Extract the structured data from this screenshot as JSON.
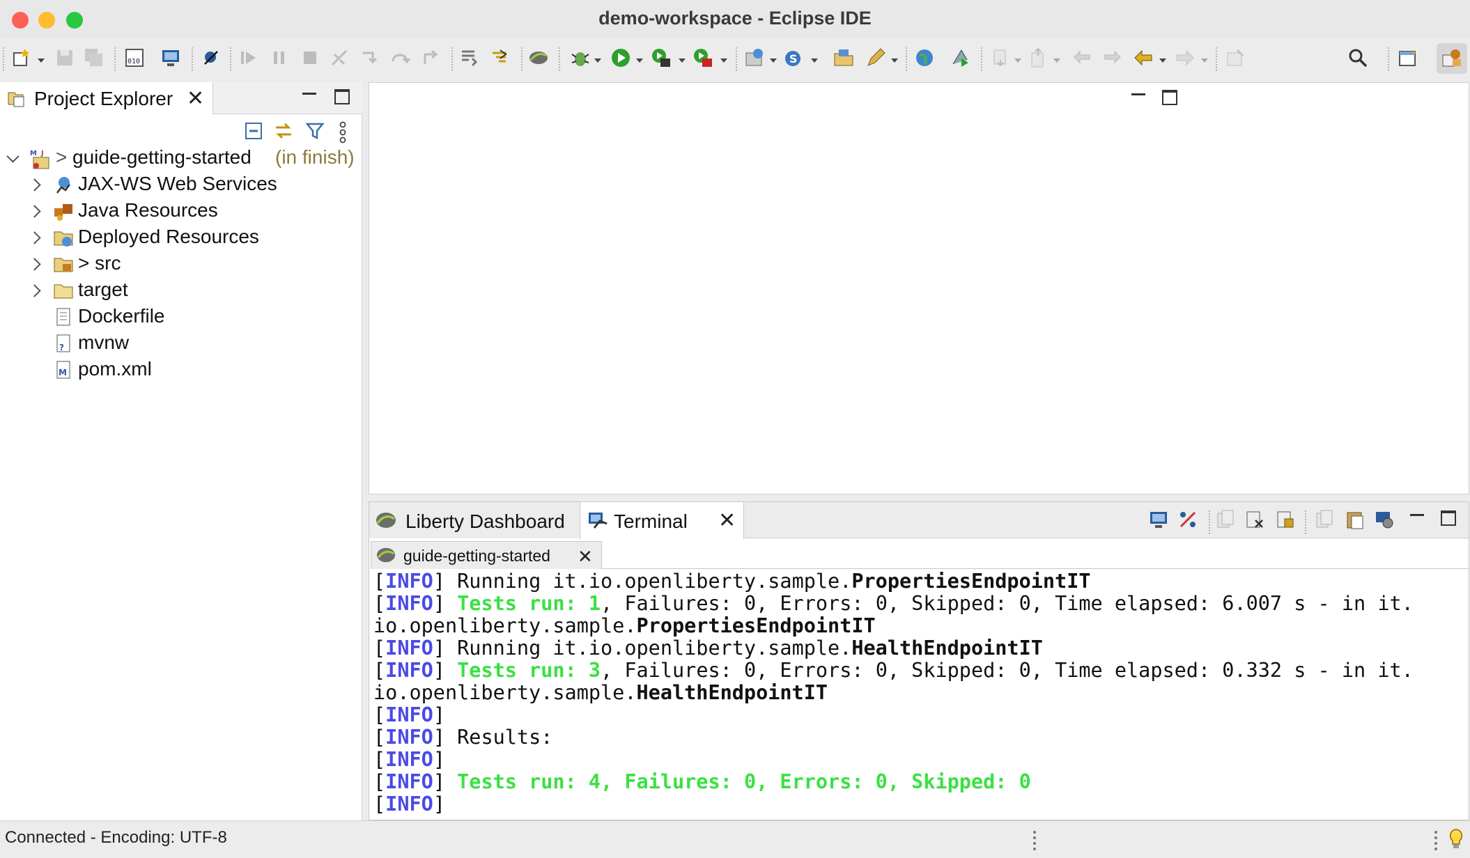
{
  "window": {
    "title": "demo-workspace - Eclipse IDE",
    "traffic_lights": {
      "close": "#ff5f57",
      "minimize": "#febc2e",
      "zoom": "#28c840"
    }
  },
  "toolbar": {
    "icons": [
      "new-wizard-icon",
      "save-icon",
      "save-all-icon",
      "binary-icon",
      "open-terminal-icon",
      "skip-breakpoints-icon",
      "resume-icon",
      "suspend-icon",
      "terminate-icon",
      "disconnect-icon",
      "step-into-icon",
      "step-over-icon",
      "step-return-icon",
      "drop-to-frame-icon",
      "use-step-filters-icon",
      "liberty-icon",
      "debug-icon",
      "run-icon",
      "coverage-icon",
      "external-tools-icon",
      "new-server-icon",
      "new-service-icon",
      "open-folder-icon",
      "edit-icon",
      "globe-icon",
      "deploy-icon",
      "next-annotation-icon",
      "prev-annotation-icon",
      "last-edit-icon",
      "forward-edit-icon",
      "back-icon",
      "forward-icon",
      "pin-editor-icon",
      "search-icon",
      "open-perspective-icon",
      "java-ee-perspective-icon"
    ]
  },
  "project_explorer": {
    "tab_label": "Project Explorer",
    "root": {
      "marker": ">",
      "name": "guide-getting-started",
      "decoration": "(in finish)"
    },
    "items": [
      {
        "label": "JAX-WS Web Services",
        "expandable": true,
        "icon": "web-services-icon"
      },
      {
        "label": "Java Resources",
        "expandable": true,
        "icon": "java-resources-icon"
      },
      {
        "label": "Deployed Resources",
        "expandable": true,
        "icon": "deployed-resources-icon"
      },
      {
        "label": "> src",
        "expandable": true,
        "icon": "source-folder-icon"
      },
      {
        "label": "target",
        "expandable": true,
        "icon": "folder-icon"
      },
      {
        "label": "Dockerfile",
        "expandable": false,
        "icon": "file-icon"
      },
      {
        "label": "mvnw",
        "expandable": false,
        "icon": "unknown-file-icon"
      },
      {
        "label": "pom.xml",
        "expandable": false,
        "icon": "maven-pom-icon"
      }
    ],
    "decoration_color": "#8b7a3a"
  },
  "bottom_panel": {
    "tabs": [
      {
        "label": "Liberty Dashboard"
      },
      {
        "label": "Terminal"
      }
    ],
    "terminal_tab": "guide-getting-started",
    "console_lines": [
      [
        {
          "t": "[",
          "s": "n"
        },
        {
          "t": "INFO",
          "s": "info"
        },
        {
          "t": "] Running it.io.openliberty.sample.",
          "s": "n"
        },
        {
          "t": "PropertiesEndpointIT",
          "s": "b"
        }
      ],
      [
        {
          "t": "[",
          "s": "n"
        },
        {
          "t": "INFO",
          "s": "info"
        },
        {
          "t": "] ",
          "s": "n"
        },
        {
          "t": "Tests run: 1",
          "s": "g"
        },
        {
          "t": ", Failures: 0, Errors: 0, Skipped: 0, Time elapsed: 6.007 s - in it.",
          "s": "n"
        }
      ],
      [
        {
          "t": "io.openliberty.sample.",
          "s": "n"
        },
        {
          "t": "PropertiesEndpointIT",
          "s": "b"
        }
      ],
      [
        {
          "t": "[",
          "s": "n"
        },
        {
          "t": "INFO",
          "s": "info"
        },
        {
          "t": "] Running it.io.openliberty.sample.",
          "s": "n"
        },
        {
          "t": "HealthEndpointIT",
          "s": "b"
        }
      ],
      [
        {
          "t": "[",
          "s": "n"
        },
        {
          "t": "INFO",
          "s": "info"
        },
        {
          "t": "] ",
          "s": "n"
        },
        {
          "t": "Tests run: 3",
          "s": "g"
        },
        {
          "t": ", Failures: 0, Errors: 0, Skipped: 0, Time elapsed: 0.332 s - in it.",
          "s": "n"
        }
      ],
      [
        {
          "t": "io.openliberty.sample.",
          "s": "n"
        },
        {
          "t": "HealthEndpointIT",
          "s": "b"
        }
      ],
      [
        {
          "t": "[",
          "s": "n"
        },
        {
          "t": "INFO",
          "s": "info"
        },
        {
          "t": "]",
          "s": "n"
        }
      ],
      [
        {
          "t": "[",
          "s": "n"
        },
        {
          "t": "INFO",
          "s": "info"
        },
        {
          "t": "] Results:",
          "s": "n"
        }
      ],
      [
        {
          "t": "[",
          "s": "n"
        },
        {
          "t": "INFO",
          "s": "info"
        },
        {
          "t": "]",
          "s": "n"
        }
      ],
      [
        {
          "t": "[",
          "s": "n"
        },
        {
          "t": "INFO",
          "s": "info"
        },
        {
          "t": "] ",
          "s": "n"
        },
        {
          "t": "Tests run: 4, Failures: 0, Errors: 0, Skipped: 0",
          "s": "g"
        }
      ],
      [
        {
          "t": "[",
          "s": "n"
        },
        {
          "t": "INFO",
          "s": "info"
        },
        {
          "t": "]",
          "s": "n"
        }
      ]
    ],
    "colors": {
      "info": "#4a4ae6",
      "success": "#3be043"
    }
  },
  "status_bar": {
    "text": "Connected - Encoding: UTF-8"
  }
}
